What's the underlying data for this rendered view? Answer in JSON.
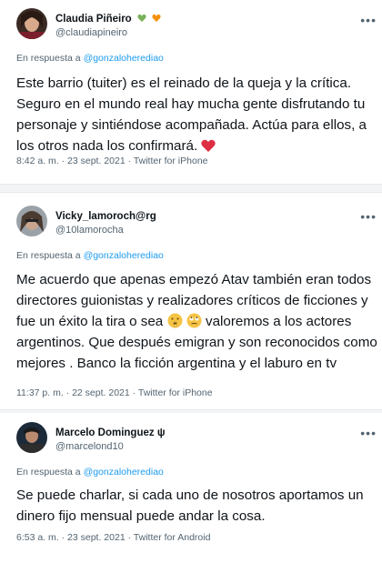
{
  "tweets": [
    {
      "name": "Claudia Piñeiro",
      "handle": "@claudiapineiro",
      "reply_prefix": "En respuesta a",
      "reply_to": "@gonzaloherediao",
      "body": "Este barrio (tuiter) es el reinado de la queja y la crítica. Seguro en el mundo real hay mucha gente disfrutando tu personaje y sintiéndose acompañada.  Actúa para ellos, a los otros nada los confirmará.",
      "meta": "8:42 a. m. · 23 sept. 2021 · Twitter for iPhone",
      "name_icons": [
        "green-heart-icon",
        "orange-heart-icon"
      ],
      "body_icons": [
        "red-heart-icon"
      ]
    },
    {
      "name": "Vicky_lamoroch@rg",
      "handle": "@10lamorocha",
      "reply_prefix": "En respuesta a",
      "reply_to": "@gonzaloherediao",
      "body_part1": "Me acuerdo que apenas empezó Atav también eran todos directores guionistas y realizadores críticos de ficciones y fue un éxito la tira o sea",
      "body_part2": "valoremos a los actores argentinos. Que después emigran y son reconocidos como mejores . Banco la ficción argentina y el laburo en tv",
      "meta": "11:37 p. m. · 22 sept. 2021 · Twitter for iPhone",
      "body_icons": [
        "shushing-face-icon",
        "face-with-rolling-eyes-icon"
      ]
    },
    {
      "name": "Marcelo Dominguez ψ",
      "handle": "@marcelond10",
      "reply_prefix": "En respuesta a",
      "reply_to": "@gonzaloherediao",
      "body": "Se puede charlar, si cada uno de nosotros aportamos un dinero fijo mensual puede andar la cosa.",
      "meta": "6:53 a. m. · 23 sept. 2021 · Twitter for Android"
    }
  ],
  "colors": {
    "link": "#1d9bf0",
    "secondary": "#536471",
    "text": "#0f1419",
    "divider": "#f2f4f5"
  },
  "more_icon": "more-options-icon"
}
